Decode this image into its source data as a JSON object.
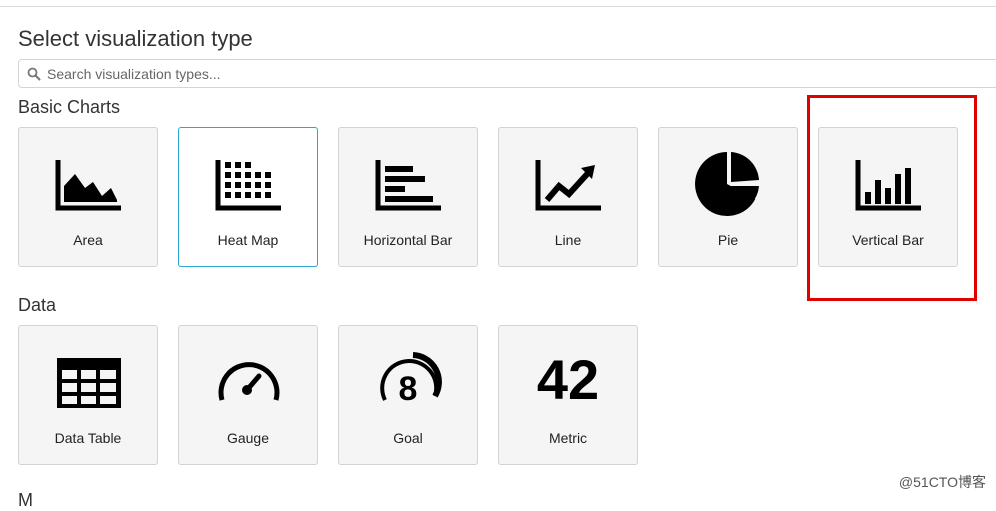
{
  "title": "Select visualization type",
  "search": {
    "placeholder": "Search visualization types..."
  },
  "sections": [
    {
      "title": "Basic Charts",
      "items": [
        {
          "label": "Area",
          "icon": "area-chart-icon"
        },
        {
          "label": "Heat Map",
          "icon": "heat-map-icon",
          "selected": true
        },
        {
          "label": "Horizontal Bar",
          "icon": "horizontal-bar-icon"
        },
        {
          "label": "Line",
          "icon": "line-chart-icon"
        },
        {
          "label": "Pie",
          "icon": "pie-chart-icon"
        },
        {
          "label": "Vertical Bar",
          "icon": "vertical-bar-icon",
          "highlighted": true
        }
      ]
    },
    {
      "title": "Data",
      "items": [
        {
          "label": "Data Table",
          "icon": "data-table-icon"
        },
        {
          "label": "Gauge",
          "icon": "gauge-icon"
        },
        {
          "label": "Goal",
          "icon": "goal-icon",
          "glyph": "8"
        },
        {
          "label": "Metric",
          "icon": "metric-icon",
          "glyph": "42"
        }
      ]
    },
    {
      "title": "M"
    }
  ],
  "colors": {
    "selected_border": "#2ea5cf",
    "annotation": "#e00000"
  },
  "watermark": "@51CTO博客"
}
